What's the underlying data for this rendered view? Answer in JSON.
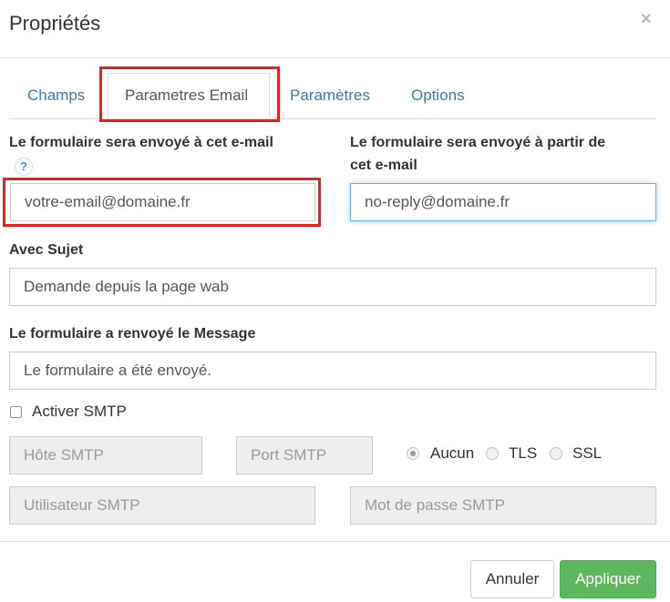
{
  "modal": {
    "title": "Propriétés"
  },
  "tabs": [
    {
      "label": "Champs"
    },
    {
      "label": "Parametres Email",
      "active": true
    },
    {
      "label": "Paramètres"
    },
    {
      "label": "Options"
    }
  ],
  "form": {
    "to_email": {
      "label": "Le formulaire sera envoyé à cet e-mail",
      "help": "?",
      "value": "votre-email@domaine.fr"
    },
    "from_email": {
      "label_line1": "Le formulaire sera envoyé à partir de",
      "label_line2": "cet e-mail",
      "value": "no-reply@domaine.fr"
    },
    "subject": {
      "label": "Avec Sujet",
      "value": "Demande depuis la page wab"
    },
    "message": {
      "label": "Le formulaire a renvoyé le Message",
      "value": "Le formulaire a été envoyé."
    },
    "smtp": {
      "checkbox_label": "Activer SMTP",
      "checked": false,
      "host_placeholder": "Hôte SMTP",
      "port_placeholder": "Port SMTP",
      "user_placeholder": "Utilisateur SMTP",
      "password_placeholder": "Mot de passe SMTP",
      "security_options": [
        "Aucun",
        "TLS",
        "SSL"
      ],
      "security_selected": "Aucun"
    }
  },
  "footer": {
    "cancel_label": "Annuler",
    "apply_label": "Appliquer"
  },
  "colors": {
    "link": "#337ab7",
    "highlight": "#e81f1f",
    "success": "#5cb85c",
    "focus": "#66afe9"
  }
}
